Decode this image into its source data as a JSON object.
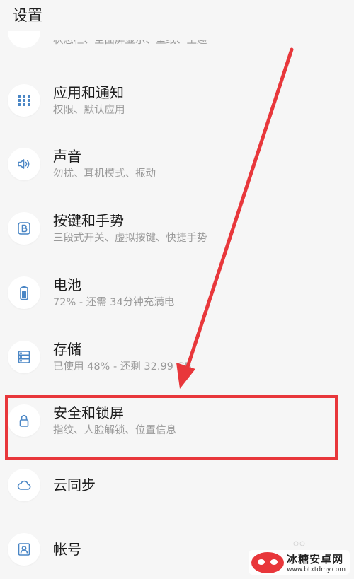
{
  "header": {
    "title": "设置"
  },
  "partial_item": {
    "subtitle": "状态栏、全面屏显示、壁纸、主题"
  },
  "items": [
    {
      "title": "应用和通知",
      "subtitle": "权限、默认应用",
      "icon": "apps-grid-icon"
    },
    {
      "title": "声音",
      "subtitle": "勿扰、耳机模式、振动",
      "icon": "speaker-icon"
    },
    {
      "title": "按键和手势",
      "subtitle": "三段式开关、虚拟按键、快捷手势",
      "icon": "button-b-icon"
    },
    {
      "title": "电池",
      "subtitle": "72% - 还需 34分钟充满电",
      "icon": "battery-icon"
    },
    {
      "title": "存储",
      "subtitle": "已使用 48% - 还剩 32.99 GB",
      "icon": "storage-icon"
    },
    {
      "title": "安全和锁屏",
      "subtitle": "指纹、人脸解锁、位置信息",
      "icon": "lock-icon"
    },
    {
      "title": "云同步",
      "subtitle": "",
      "icon": "cloud-icon"
    },
    {
      "title": "帐号",
      "subtitle": "",
      "icon": "account-icon"
    }
  ],
  "annotation": {
    "color": "#e8373b"
  },
  "accent_color": "#4a86c5",
  "watermark": {
    "name": "冰糖安卓网",
    "url": "www.btxtdmy.com"
  }
}
